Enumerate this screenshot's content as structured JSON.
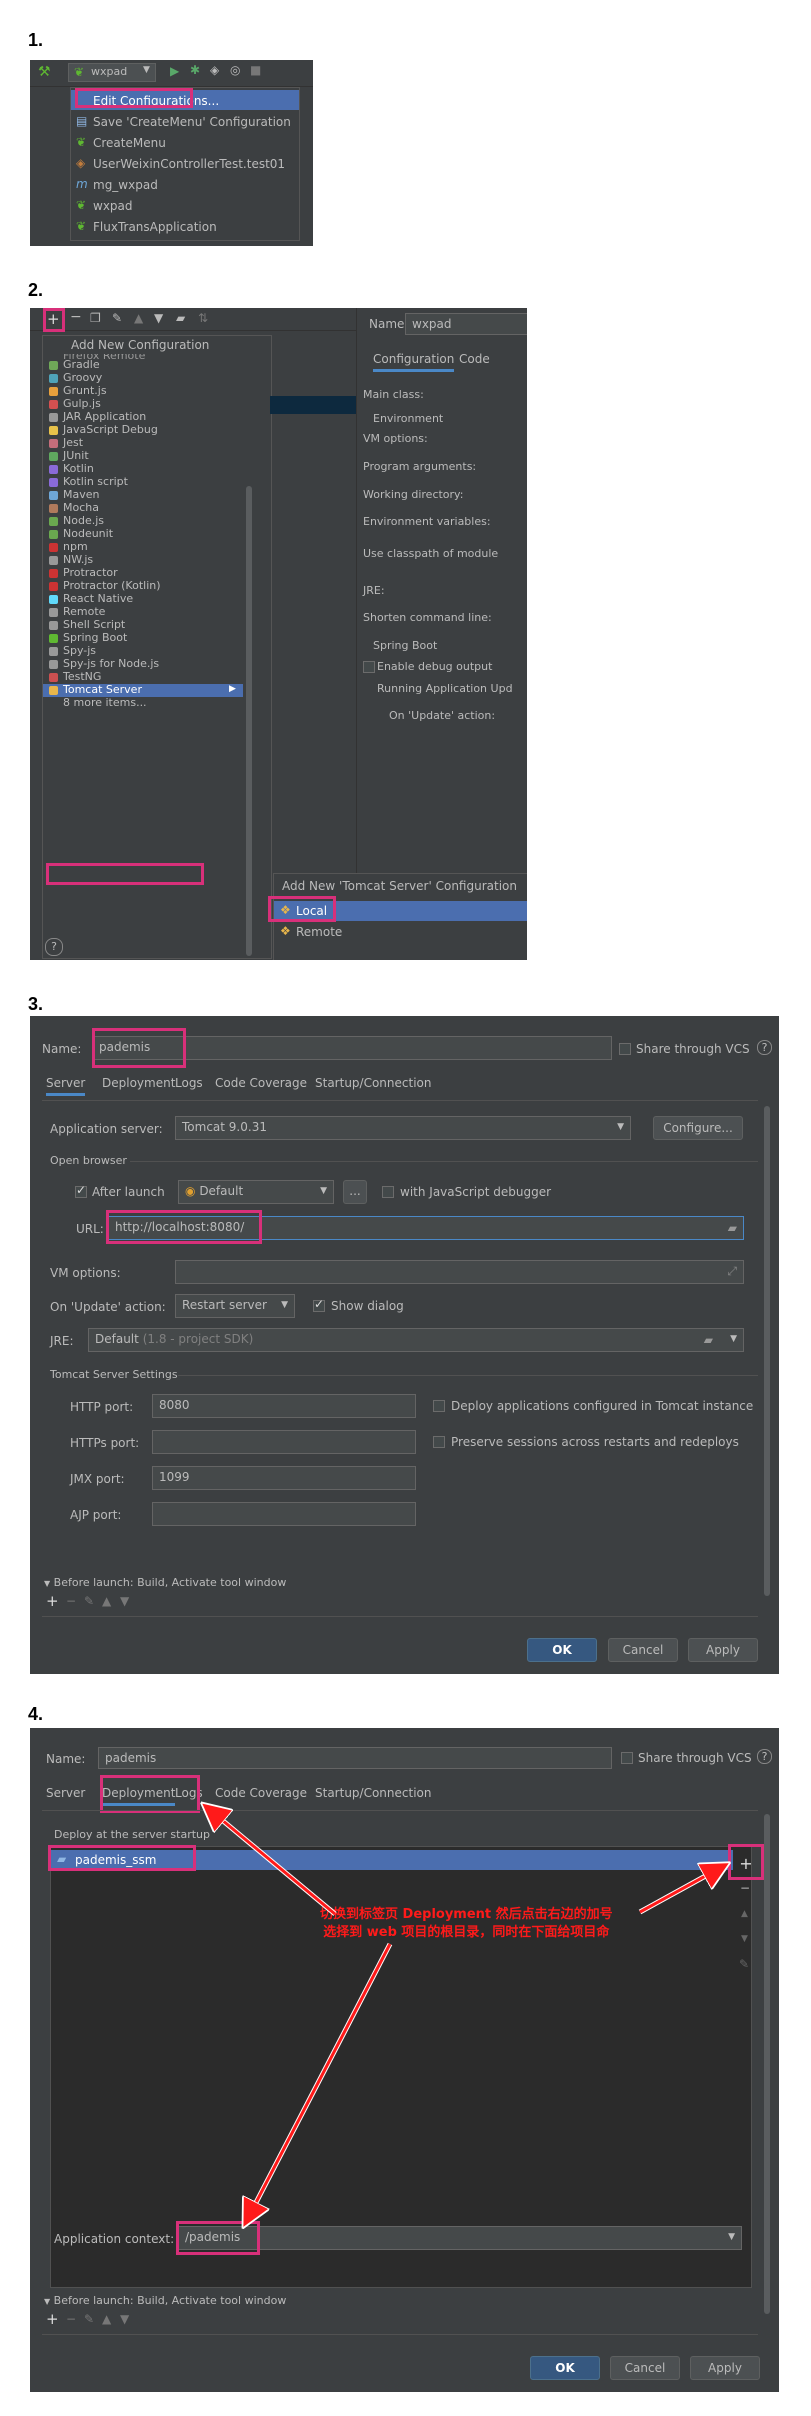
{
  "steps": [
    "1.",
    "2.",
    "3.",
    "4."
  ],
  "step1": {
    "run_config_label": "wxpad",
    "menu_items": [
      "Edit Configurations...",
      "Save 'CreateMenu' Configuration",
      "CreateMenu",
      "UserWeixinControllerTest.test01",
      "mg_wxpad",
      "wxpad",
      "FluxTransApplication"
    ]
  },
  "step2": {
    "toolbar_plus": "+",
    "add_new_config": "Add New Configuration",
    "partial_top_item": "Firefox Remote",
    "config_types": [
      "Gradle",
      "Groovy",
      "Grunt.js",
      "Gulp.js",
      "JAR Application",
      "JavaScript Debug",
      "Jest",
      "JUnit",
      "Kotlin",
      "Kotlin script",
      "Maven",
      "Mocha",
      "Node.js",
      "Nodeunit",
      "npm",
      "NW.js",
      "Protractor",
      "Protractor (Kotlin)",
      "React Native",
      "Remote",
      "Shell Script",
      "Spring Boot",
      "Spy-js",
      "Spy-js for Node.js",
      "TestNG",
      "Tomcat Server",
      "8 more items..."
    ],
    "submenu_title": "Add New 'Tomcat Server' Configuration",
    "submenu_items": [
      "Local",
      "Remote"
    ],
    "name_label": "Name:",
    "name_value": "wxpad",
    "tabs": [
      "Configuration",
      "Code"
    ],
    "fields": [
      "Main class:",
      "Environment",
      "VM options:",
      "Program arguments:",
      "Working directory:",
      "Environment variables:",
      "Use classpath of module",
      "JRE:",
      "Shorten command line:",
      "Spring Boot",
      "Enable debug output",
      "Running Application Upd",
      "On 'Update' action:"
    ],
    "help": "?"
  },
  "step3": {
    "name_label": "Name:",
    "name_value": "pademis",
    "share_vcs": "Share through VCS",
    "tabs": [
      "Server",
      "Deployment",
      "Logs",
      "Code Coverage",
      "Startup/Connection"
    ],
    "app_server_label": "Application server:",
    "app_server_value": "Tomcat 9.0.31",
    "configure_button": "Configure...",
    "open_browser": "Open browser",
    "after_launch": "After launch",
    "browser_value": "Default",
    "ellipsis": "...",
    "js_debugger": "with JavaScript debugger",
    "url_label": "URL:",
    "url_value": "http://localhost:8080/",
    "vm_options_label": "VM options:",
    "on_update_label": "On 'Update' action:",
    "on_update_value": "Restart server",
    "show_dialog": "Show dialog",
    "jre_label": "JRE:",
    "jre_value": "Default",
    "jre_hint": "(1.8 - project SDK)",
    "tomcat_settings": "Tomcat Server Settings",
    "http_port_label": "HTTP port:",
    "http_port_value": "8080",
    "https_port_label": "HTTPs port:",
    "https_port_value": "",
    "jmx_port_label": "JMX port:",
    "jmx_port_value": "1099",
    "ajp_port_label": "AJP port:",
    "ajp_port_value": "",
    "deploy_apps": "Deploy applications configured in Tomcat instance",
    "preserve_sessions": "Preserve sessions across restarts and redeploys",
    "before_launch": "Before launch: Build, Activate tool window",
    "ok": "OK",
    "cancel": "Cancel",
    "apply": "Apply"
  },
  "step4": {
    "name_label": "Name:",
    "name_value": "pademis",
    "share_vcs": "Share through VCS",
    "tabs": [
      "Server",
      "Deployment",
      "Logs",
      "Code Coverage",
      "Startup/Connection"
    ],
    "deploy_label": "Deploy at the server startup",
    "artifact": "pademis_ssm",
    "plus": "+",
    "minus": "−",
    "annotation_line1": "切换到标签页 Deployment 然后点击右边的加号",
    "annotation_line2": "选择到 web 项目的根目录，同时在下面给项目命",
    "app_context_label": "Application context:",
    "app_context_value": "/pademis",
    "before_launch": "Before launch: Build, Activate tool window",
    "ok": "OK",
    "cancel": "Cancel",
    "apply": "Apply"
  },
  "colors": {
    "panel": "#3c3f41",
    "selection": "#4b6eaf",
    "highlight": "#d8307a",
    "annotation": "#ff1a1a"
  }
}
